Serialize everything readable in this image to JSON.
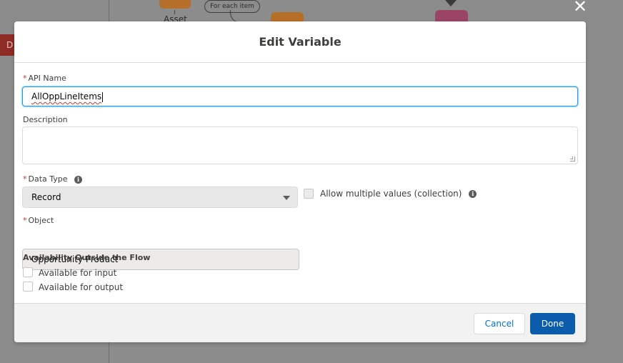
{
  "background": {
    "canvas_button_label": "D",
    "asset_label": "Asset",
    "foreach_label": "For each item",
    "close_glyph": "✕"
  },
  "modal": {
    "title": "Edit Variable",
    "api_name": {
      "required_mark": "*",
      "label": "API Name",
      "value": "AllOppLineItems"
    },
    "description": {
      "label": "Description",
      "value": ""
    },
    "data_type": {
      "required_mark": "*",
      "label": "Data Type",
      "info_glyph": "i",
      "selected": "Record"
    },
    "allow_multiple": {
      "label": "Allow multiple values (collection)",
      "checked": false,
      "info_glyph": "i"
    },
    "object": {
      "required_mark": "*",
      "label": "Object",
      "value": "Opportunity Product"
    },
    "availability": {
      "heading": "Availability Outside the Flow",
      "input_label": "Available for input",
      "output_label": "Available for output"
    }
  },
  "footer": {
    "cancel_label": "Cancel",
    "done_label": "Done"
  },
  "colors": {
    "primary": "#0b5cab",
    "focus_border": "#1b96ff",
    "required": "#c23934"
  }
}
